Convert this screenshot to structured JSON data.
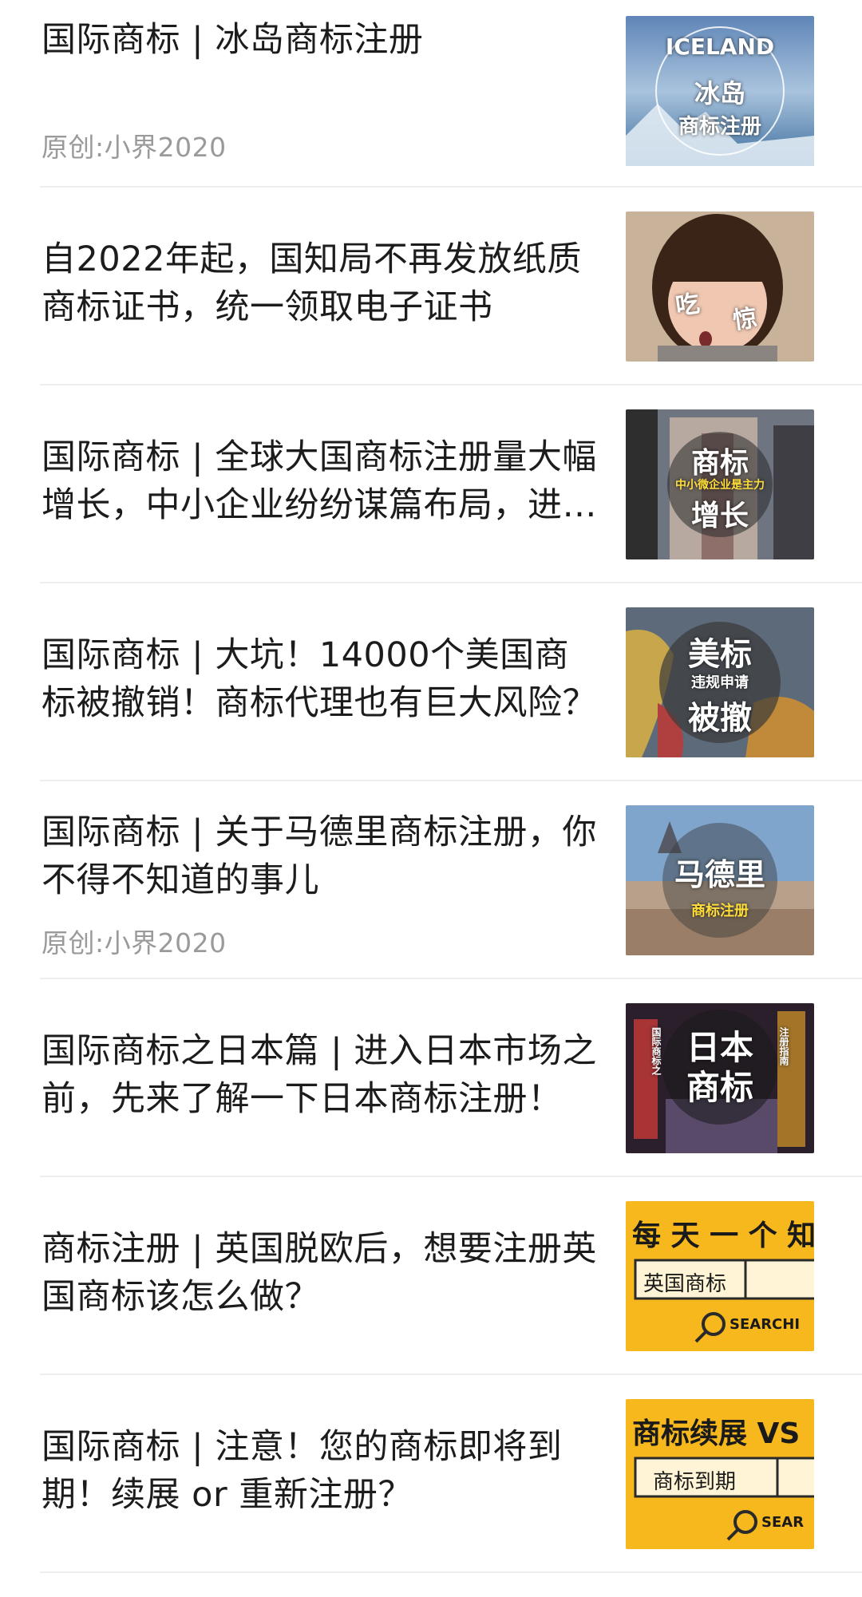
{
  "articles": [
    {
      "title": "国际商标 | 冰岛商标注册",
      "source": "原创:小界2020",
      "thumb": {
        "line1": "ICELAND",
        "line2": "冰岛",
        "line3": "商标注册"
      }
    },
    {
      "title": "自2022年起，国知局不再发放纸质商标证书，统一领取电子证书",
      "thumb": {
        "line1": "吃",
        "line2": "惊"
      }
    },
    {
      "title": "国际商标 | 全球大国商标注册量大幅增长，中小企业纷纷谋篇布局，进…",
      "thumb": {
        "line1": "商标",
        "line2": "中小微企业是主力",
        "line3": "增长"
      }
    },
    {
      "title": "国际商标 | 大坑！14000个美国商标被撤销！商标代理也有巨大风险？",
      "thumb": {
        "line1": "美标",
        "line2": "违规申请",
        "line3": "被撤"
      }
    },
    {
      "title": "国际商标 | 关于马德里商标注册，你不得不知道的事儿",
      "source": "原创:小界2020",
      "thumb": {
        "line1": "马德里",
        "line2": "商标注册"
      }
    },
    {
      "title": "国际商标之日本篇 | 进入日本市场之前，先来了解一下日本商标注册！",
      "thumb": {
        "line1": "日本",
        "line2": "商标",
        "line3": "国际商标之",
        "line4": "注册指南"
      }
    },
    {
      "title": "商标注册 | 英国脱欧后，想要注册英国商标该怎么做？",
      "thumb": {
        "line1": "每 天 一 个 知",
        "line2": "英国商标",
        "line3": "SEARCHI"
      }
    },
    {
      "title": "国际商标 | 注意！您的商标即将到期！续展 or 重新注册？",
      "thumb": {
        "line1": "商标续展 VS",
        "line2": "商标到期",
        "line3": "SEAR"
      }
    }
  ],
  "colors": {
    "title": "#1c1c1c",
    "source": "#9a9a9a",
    "divider": "#ededed",
    "thumb_yellow": "#f6b81c"
  }
}
